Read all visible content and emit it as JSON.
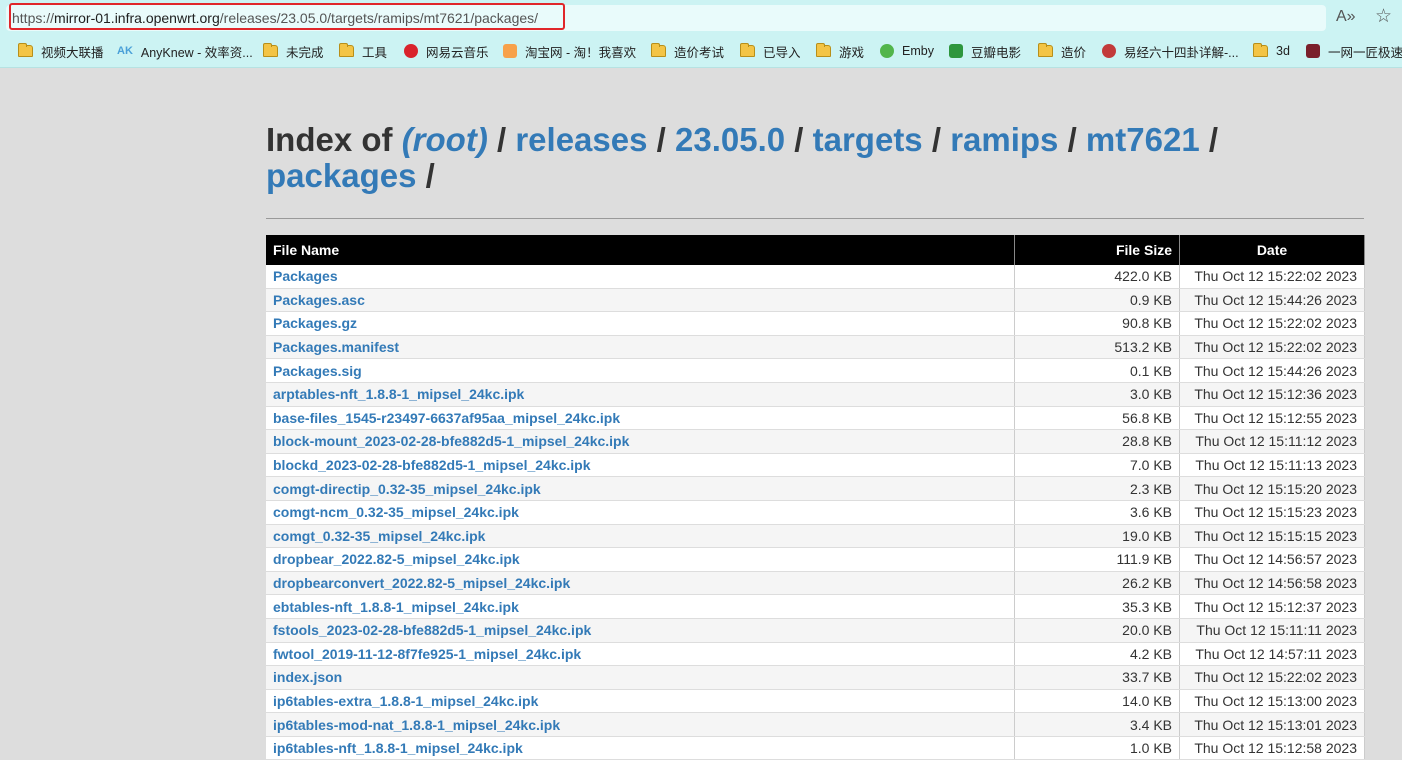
{
  "browser": {
    "url_scheme": "https://",
    "url_host": "mirror-01.infra.openwrt.org",
    "url_path": "/releases/23.05.0/targets/ramips/mt7621/packages/",
    "read_aloud_icon": "A»",
    "favorite_icon": "☆"
  },
  "bookmarks": [
    {
      "label": "视频大联播",
      "icon": "folder"
    },
    {
      "label": "AnyKnew - 效率资...",
      "icon": "AK"
    },
    {
      "label": "未完成",
      "icon": "folder"
    },
    {
      "label": "工具",
      "icon": "folder"
    },
    {
      "label": "网易云音乐",
      "icon": "netease-music"
    },
    {
      "label": "淘宝网 - 淘！我喜欢",
      "icon": "taobao"
    },
    {
      "label": "造价考试",
      "icon": "folder"
    },
    {
      "label": "已导入",
      "icon": "folder"
    },
    {
      "label": "游戏",
      "icon": "folder"
    },
    {
      "label": "Emby",
      "icon": "emby"
    },
    {
      "label": "豆瓣电影",
      "icon": "douban"
    },
    {
      "label": "造价",
      "icon": "folder"
    },
    {
      "label": "易经六十四卦详解-...",
      "icon": "yijing"
    },
    {
      "label": "3d",
      "icon": "folder"
    },
    {
      "label": "一网一匠极速",
      "icon": "yiwang"
    }
  ],
  "page": {
    "index_of": "Index of",
    "crumbs": [
      "(root)",
      "releases",
      "23.05.0",
      "targets",
      "ramips",
      "mt7621",
      "packages"
    ],
    "sep": "/"
  },
  "table": {
    "headers": {
      "name": "File Name",
      "size": "File Size",
      "date": "Date"
    },
    "rows": [
      {
        "name": "Packages",
        "size": "422.0 KB",
        "date": "Thu Oct 12 15:22:02 2023"
      },
      {
        "name": "Packages.asc",
        "size": "0.9 KB",
        "date": "Thu Oct 12 15:44:26 2023"
      },
      {
        "name": "Packages.gz",
        "size": "90.8 KB",
        "date": "Thu Oct 12 15:22:02 2023"
      },
      {
        "name": "Packages.manifest",
        "size": "513.2 KB",
        "date": "Thu Oct 12 15:22:02 2023"
      },
      {
        "name": "Packages.sig",
        "size": "0.1 KB",
        "date": "Thu Oct 12 15:44:26 2023"
      },
      {
        "name": "arptables-nft_1.8.8-1_mipsel_24kc.ipk",
        "size": "3.0 KB",
        "date": "Thu Oct 12 15:12:36 2023"
      },
      {
        "name": "base-files_1545-r23497-6637af95aa_mipsel_24kc.ipk",
        "size": "56.8 KB",
        "date": "Thu Oct 12 15:12:55 2023"
      },
      {
        "name": "block-mount_2023-02-28-bfe882d5-1_mipsel_24kc.ipk",
        "size": "28.8 KB",
        "date": "Thu Oct 12 15:11:12 2023"
      },
      {
        "name": "blockd_2023-02-28-bfe882d5-1_mipsel_24kc.ipk",
        "size": "7.0 KB",
        "date": "Thu Oct 12 15:11:13 2023"
      },
      {
        "name": "comgt-directip_0.32-35_mipsel_24kc.ipk",
        "size": "2.3 KB",
        "date": "Thu Oct 12 15:15:20 2023"
      },
      {
        "name": "comgt-ncm_0.32-35_mipsel_24kc.ipk",
        "size": "3.6 KB",
        "date": "Thu Oct 12 15:15:23 2023"
      },
      {
        "name": "comgt_0.32-35_mipsel_24kc.ipk",
        "size": "19.0 KB",
        "date": "Thu Oct 12 15:15:15 2023"
      },
      {
        "name": "dropbear_2022.82-5_mipsel_24kc.ipk",
        "size": "111.9 KB",
        "date": "Thu Oct 12 14:56:57 2023"
      },
      {
        "name": "dropbearconvert_2022.82-5_mipsel_24kc.ipk",
        "size": "26.2 KB",
        "date": "Thu Oct 12 14:56:58 2023"
      },
      {
        "name": "ebtables-nft_1.8.8-1_mipsel_24kc.ipk",
        "size": "35.3 KB",
        "date": "Thu Oct 12 15:12:37 2023"
      },
      {
        "name": "fstools_2023-02-28-bfe882d5-1_mipsel_24kc.ipk",
        "size": "20.0 KB",
        "date": "Thu Oct 12 15:11:11 2023"
      },
      {
        "name": "fwtool_2019-11-12-8f7fe925-1_mipsel_24kc.ipk",
        "size": "4.2 KB",
        "date": "Thu Oct 12 14:57:11 2023"
      },
      {
        "name": "index.json",
        "size": "33.7 KB",
        "date": "Thu Oct 12 15:22:02 2023"
      },
      {
        "name": "ip6tables-extra_1.8.8-1_mipsel_24kc.ipk",
        "size": "14.0 KB",
        "date": "Thu Oct 12 15:13:00 2023"
      },
      {
        "name": "ip6tables-mod-nat_1.8.8-1_mipsel_24kc.ipk",
        "size": "3.4 KB",
        "date": "Thu Oct 12 15:13:01 2023"
      },
      {
        "name": "ip6tables-nft_1.8.8-1_mipsel_24kc.ipk",
        "size": "1.0 KB",
        "date": "Thu Oct 12 15:12:58 2023"
      }
    ]
  },
  "colors": {
    "chrome_bg": "#ccf3f3",
    "link": "#337ab7",
    "page_bg": "#dddddd",
    "highlight_box": "#e0262a"
  }
}
